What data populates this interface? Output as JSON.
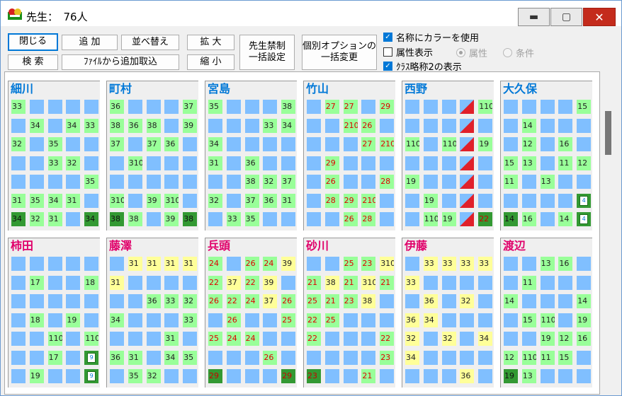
{
  "window": {
    "title": "先生：　76人",
    "min_glyph": "▬",
    "max_glyph": "▢",
    "close_glyph": "✕",
    "icon": "app-icon"
  },
  "toolbar": {
    "close": "閉じる",
    "add": "追 加",
    "sort": "並べ替え",
    "zoom_in": "拡 大",
    "search": "検 索",
    "add_from_file": "ﾌｧｲﾙから追加取込",
    "zoom_out": "縮 小",
    "bulk_ban_1": "先生禁制",
    "bulk_ban_2": "一括設定",
    "bulk_opt_1": "個別オプションの",
    "bulk_opt_2": "一括変更"
  },
  "options": {
    "use_color_name": {
      "label": "名称にカラーを使用",
      "checked": true
    },
    "show_attribute": {
      "label": "属性表示",
      "checked": false
    },
    "radio_attribute": {
      "label": "属性",
      "selected": true,
      "enabled": false
    },
    "radio_condition": {
      "label": "条件",
      "selected": false,
      "enabled": false
    },
    "class_abbrev2": {
      "label": "ｸﾗｽ略称2の表示",
      "checked": true
    }
  },
  "colors": {
    "blue": "#80bfff",
    "green": "#99ff99",
    "yellow": "#ffff99",
    "dark_green": "#339933",
    "name_blue": "#0078d7",
    "name_pink": "#e0006a"
  },
  "teachers": [
    {
      "name": "細川",
      "color": "#0078d7",
      "rows": [
        [
          "g:33",
          "b",
          "b",
          "b",
          "b"
        ],
        [
          "b",
          "g:34",
          "b",
          "g:34",
          "g:33"
        ],
        [
          "g:32",
          "b",
          "g:35",
          "b",
          "b"
        ],
        [
          "b",
          "b",
          "g:33",
          "g:32",
          "b"
        ],
        [
          "b",
          "b",
          "b",
          "b",
          "g:35"
        ],
        [
          "g:31",
          "g:35",
          "g:34",
          "g:31",
          "b"
        ],
        [
          "dg:34",
          "g:32",
          "g:31",
          "b",
          "dg:34"
        ]
      ]
    },
    {
      "name": "町村",
      "color": "#0078d7",
      "rows": [
        [
          "g:36",
          "b",
          "b",
          "b",
          "g:37"
        ],
        [
          "g:38",
          "g:36",
          "g:38",
          "b",
          "g:39"
        ],
        [
          "g:37",
          "b",
          "g:37",
          "g:36",
          "b"
        ],
        [
          "b",
          "g:310",
          "b",
          "b",
          "b"
        ],
        [
          "b",
          "b",
          "b",
          "b",
          "b"
        ],
        [
          "g:310",
          "b",
          "g:39",
          "g:310",
          "b"
        ],
        [
          "dg:38",
          "g:38",
          "b",
          "g:39",
          "dg:38"
        ]
      ]
    },
    {
      "name": "宮島",
      "color": "#0078d7",
      "rows": [
        [
          "g:35",
          "b",
          "b",
          "b",
          "g:38"
        ],
        [
          "b",
          "b",
          "b",
          "g:33",
          "g:34"
        ],
        [
          "g:34",
          "b",
          "b",
          "b",
          "b"
        ],
        [
          "g:31",
          "b",
          "g:36",
          "b",
          "b"
        ],
        [
          "b",
          "b",
          "g:38",
          "g:32",
          "g:37"
        ],
        [
          "g:32",
          "b",
          "g:37",
          "g:36",
          "g:31"
        ],
        [
          "b",
          "g:33",
          "g:35",
          "b",
          "b"
        ]
      ]
    },
    {
      "name": "竹山",
      "color": "#0078d7",
      "rows": [
        [
          "b",
          "p:27",
          "p:27",
          "b",
          "p:29"
        ],
        [
          "b",
          "b",
          "p:210",
          "p:26",
          "b"
        ],
        [
          "b",
          "b",
          "b",
          "p:27",
          "p:210"
        ],
        [
          "b",
          "p:29",
          "b",
          "b",
          "b"
        ],
        [
          "b",
          "p:26",
          "b",
          "b",
          "p:28"
        ],
        [
          "b",
          "p:28",
          "p:29",
          "p:210",
          "b"
        ],
        [
          "b",
          "b",
          "p:26",
          "p:28",
          "b"
        ]
      ]
    },
    {
      "name": "西野",
      "color": "#0078d7",
      "rows": [
        [
          "b",
          "b",
          "b",
          "tri",
          "g:110"
        ],
        [
          "b",
          "b",
          "b",
          "tri",
          "b"
        ],
        [
          "g:110",
          "b",
          "g:110",
          "tri",
          "g:19"
        ],
        [
          "b",
          "b",
          "b",
          "tri",
          "b"
        ],
        [
          "g:19",
          "b",
          "b",
          "tri",
          "b"
        ],
        [
          "b",
          "g:19",
          "b",
          "tri",
          "b"
        ],
        [
          "b",
          "g:110",
          "g:19",
          "tri",
          "dp:22"
        ]
      ]
    },
    {
      "name": "大久保",
      "color": "#0078d7",
      "rows": [
        [
          "b",
          "b",
          "b",
          "b",
          "g:15"
        ],
        [
          "b",
          "g:14",
          "b",
          "b",
          "b"
        ],
        [
          "b",
          "g:12",
          "b",
          "g:16",
          "b"
        ],
        [
          "g:15",
          "g:13",
          "b",
          "g:11",
          "g:12"
        ],
        [
          "g:11",
          "b",
          "g:13",
          "b",
          "b"
        ],
        [
          "b",
          "b",
          "b",
          "b",
          "ic:4"
        ],
        [
          "dg:14",
          "g:16",
          "b",
          "g:14",
          "ic:4"
        ]
      ]
    },
    {
      "name": "柿田",
      "color": "#e0006a",
      "rows": [
        [
          "b",
          "b",
          "b",
          "b",
          "b"
        ],
        [
          "b",
          "g:17",
          "b",
          "b",
          "g:18"
        ],
        [
          "b",
          "b",
          "b",
          "b",
          "b"
        ],
        [
          "b",
          "g:18",
          "b",
          "g:19",
          "b"
        ],
        [
          "b",
          "b",
          "g:110",
          "b",
          "g:110"
        ],
        [
          "b",
          "b",
          "g:17",
          "b",
          "ic:9"
        ],
        [
          "b",
          "g:19",
          "b",
          "b",
          "ic:9"
        ]
      ]
    },
    {
      "name": "藤澤",
      "color": "#e0006a",
      "rows": [
        [
          "b",
          "y:31",
          "y:31",
          "y:31",
          "y:31"
        ],
        [
          "y:31",
          "b",
          "b",
          "b",
          "b"
        ],
        [
          "b",
          "b",
          "g:36",
          "g:33",
          "g:32"
        ],
        [
          "g:34",
          "b",
          "b",
          "b",
          "g:33"
        ],
        [
          "b",
          "b",
          "b",
          "g:31",
          "b"
        ],
        [
          "g:36",
          "g:31",
          "b",
          "g:34",
          "g:35"
        ],
        [
          "b",
          "g:35",
          "g:32",
          "b",
          "b"
        ]
      ]
    },
    {
      "name": "兵頭",
      "color": "#e0006a",
      "rows": [
        [
          "p:24",
          "b",
          "p:26",
          "p:24",
          "y:39"
        ],
        [
          "p:22",
          "y:37",
          "p:22",
          "y:39",
          "b"
        ],
        [
          "p:26",
          "p:22",
          "p:24",
          "y:37",
          "p:26"
        ],
        [
          "b",
          "p:26",
          "b",
          "b",
          "p:25"
        ],
        [
          "p:25",
          "p:24",
          "p:24",
          "b",
          "b"
        ],
        [
          "b",
          "b",
          "b",
          "p:26",
          "b"
        ],
        [
          "dp:29",
          "b",
          "b",
          "b",
          "dp:29"
        ]
      ]
    },
    {
      "name": "砂川",
      "color": "#e0006a",
      "rows": [
        [
          "b",
          "b",
          "p:25",
          "p:23",
          "y:310"
        ],
        [
          "p:21",
          "y:38",
          "p:21",
          "y:310",
          "p:21"
        ],
        [
          "p:25",
          "p:21",
          "p:23",
          "y:38",
          "b"
        ],
        [
          "p:22",
          "p:25",
          "b",
          "b",
          "b"
        ],
        [
          "p:22",
          "b",
          "b",
          "b",
          "p:22"
        ],
        [
          "b",
          "b",
          "b",
          "b",
          "p:23"
        ],
        [
          "dp:23",
          "b",
          "b",
          "p:21",
          "b"
        ]
      ]
    },
    {
      "name": "伊藤",
      "color": "#e0006a",
      "rows": [
        [
          "b",
          "y:33",
          "y:33",
          "y:33",
          "y:33"
        ],
        [
          "y:33",
          "b",
          "b",
          "b",
          "b"
        ],
        [
          "b",
          "y:36",
          "b",
          "y:32",
          "b"
        ],
        [
          "y:36",
          "y:34",
          "b",
          "b",
          "b"
        ],
        [
          "y:32",
          "b",
          "y:32",
          "b",
          "y:34"
        ],
        [
          "y:34",
          "b",
          "b",
          "b",
          "b"
        ],
        [
          "b",
          "b",
          "b",
          "y:36",
          "b"
        ]
      ]
    },
    {
      "name": "渡辺",
      "color": "#e0006a",
      "rows": [
        [
          "b",
          "b",
          "g:13",
          "g:16",
          "b"
        ],
        [
          "b",
          "g:11",
          "b",
          "b",
          "b"
        ],
        [
          "g:14",
          "b",
          "b",
          "b",
          "g:14"
        ],
        [
          "b",
          "g:15",
          "g:110",
          "b",
          "g:19"
        ],
        [
          "b",
          "b",
          "g:19",
          "g:12",
          "g:16"
        ],
        [
          "g:12",
          "g:110",
          "g:11",
          "g:15",
          "b"
        ],
        [
          "dg:19",
          "g:13",
          "b",
          "b",
          "b"
        ]
      ]
    }
  ]
}
